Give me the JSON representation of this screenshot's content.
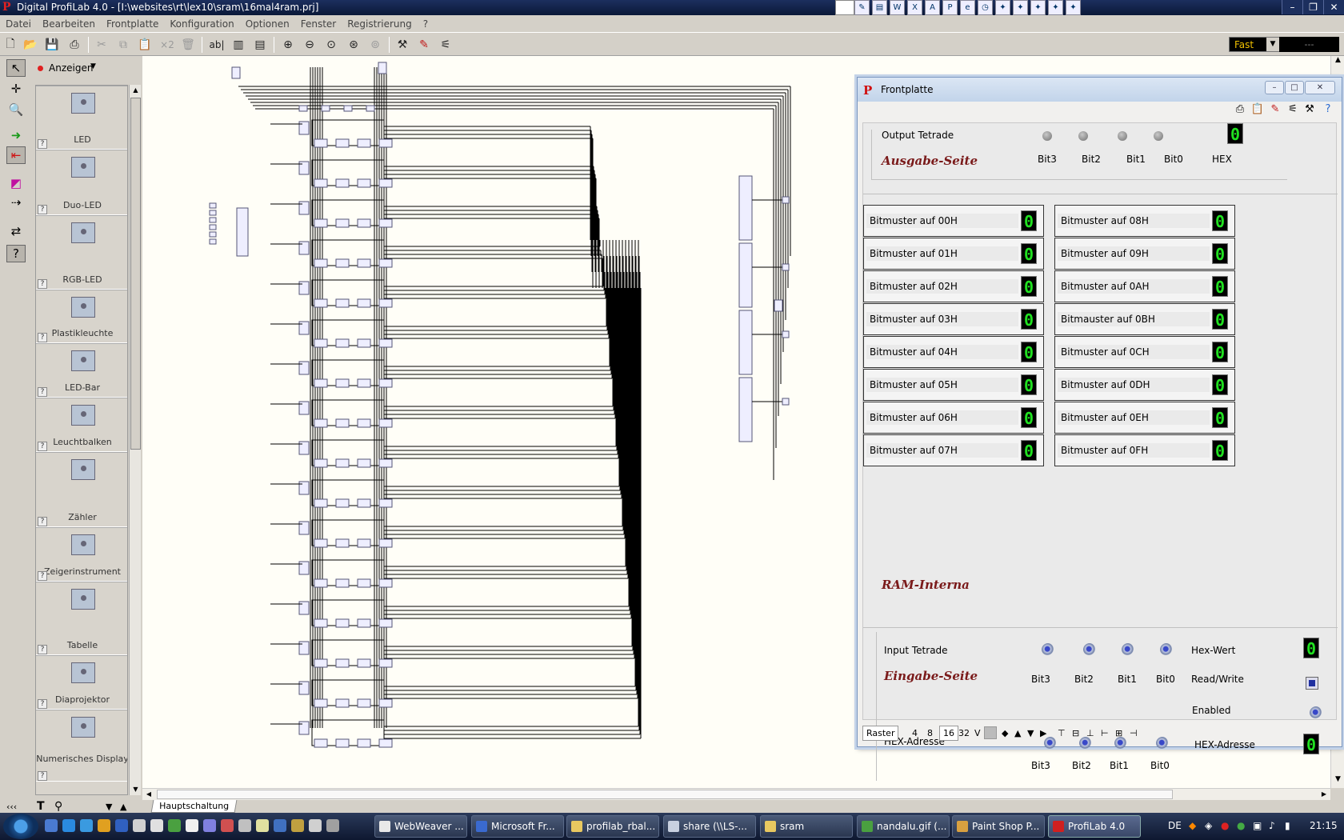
{
  "window": {
    "title": "Digital ProfiLab 4.0 - [I:\\websites\\rt\\lex10\\sram\\16mal4ram.prj]"
  },
  "menu": [
    "Datei",
    "Bearbeiten",
    "Frontplatte",
    "Konfiguration",
    "Optionen",
    "Fenster",
    "Registrierung",
    "?"
  ],
  "toolbar": {
    "copy_count_label": "×2",
    "text_label": "ab|",
    "speed": "Fast",
    "speed_value": "---"
  },
  "palette": {
    "header": "Anzeigen",
    "items": [
      {
        "label": "LED"
      },
      {
        "label": "Duo-LED"
      },
      {
        "label": "RGB-LED"
      },
      {
        "label": "Plastikleuchte"
      },
      {
        "label": "LED-Bar"
      },
      {
        "label": "Leuchtbalken"
      },
      {
        "label": "Zähler"
      },
      {
        "label": "Zeigerinstrument"
      },
      {
        "label": "Tabelle"
      },
      {
        "label": "Diaprojektor"
      },
      {
        "label": "Numerisches Display"
      }
    ],
    "help_mark": "?",
    "collapse": "‹‹‹"
  },
  "canvas": {
    "tab": "Hauptschaltung"
  },
  "frontplatte": {
    "title": "Frontplatte",
    "output": {
      "label": "Output Tetrade",
      "section": "Ausgabe-Seite",
      "bits": [
        "Bit3",
        "Bit2",
        "Bit1",
        "Bit0"
      ],
      "hex_label": "HEX",
      "hex_value": "0"
    },
    "ram": {
      "section": "RAM-Interna",
      "left": [
        {
          "label": "Bitmuster auf 00H",
          "value": "0"
        },
        {
          "label": "Bitmuster auf 01H",
          "value": "0"
        },
        {
          "label": "Bitmuster auf 02H",
          "value": "0"
        },
        {
          "label": "Bitmuster auf 03H",
          "value": "0"
        },
        {
          "label": "Bitmuster auf 04H",
          "value": "0"
        },
        {
          "label": "Bitmuster auf 05H",
          "value": "0"
        },
        {
          "label": "Bitmuster auf 06H",
          "value": "0"
        },
        {
          "label": "Bitmuster auf 07H",
          "value": "0"
        }
      ],
      "right": [
        {
          "label": "Bitmuster auf 08H",
          "value": "0"
        },
        {
          "label": "Bitmuster auf 09H",
          "value": "0"
        },
        {
          "label": "Bitmuster auf 0AH",
          "value": "0"
        },
        {
          "label": "Bitmauster auf 0BH",
          "value": "0"
        },
        {
          "label": "Bitmuster auf 0CH",
          "value": "0"
        },
        {
          "label": "Bitmuster auf 0DH",
          "value": "0"
        },
        {
          "label": "Bitmuster auf 0EH",
          "value": "0"
        },
        {
          "label": "Bitmuster auf 0FH",
          "value": "0"
        }
      ]
    },
    "input": {
      "label": "Input Tetrade",
      "section": "Eingabe-Seite",
      "bits": [
        "Bit3",
        "Bit2",
        "Bit1",
        "Bit0"
      ],
      "hex_label": "Hex-Wert",
      "hex_value": "0",
      "rw_label": "Read/Write",
      "enabled_label": "Enabled",
      "addr_label": "HEX-Adresse",
      "addr_bits": [
        "Bit3",
        "Bit2",
        "Bit1",
        "Bit0"
      ],
      "addr_hex_label": "HEX-Adresse",
      "addr_hex_value": "0"
    },
    "status": {
      "raster_label": "Raster",
      "sizes": [
        "4",
        "8",
        "16",
        "32"
      ],
      "v_label": "V"
    }
  },
  "taskbar": {
    "tasks": [
      {
        "label": "WebWeaver ...",
        "color": "#e8e8e8"
      },
      {
        "label": "Microsoft Fr...",
        "color": "#3a6ad0"
      },
      {
        "label": "profilab_rbal...",
        "color": "#e8c860"
      },
      {
        "label": "share (\\\\LS-...",
        "color": "#c8d0e0"
      },
      {
        "label": "sram",
        "color": "#e8c860"
      },
      {
        "label": "nandalu.gif (...",
        "color": "#4aa040"
      },
      {
        "label": "Paint Shop P...",
        "color": "#d8a040"
      },
      {
        "label": "ProfiLab 4.0",
        "color": "#d02020"
      }
    ],
    "lang": "DE",
    "clock": "21:15"
  }
}
